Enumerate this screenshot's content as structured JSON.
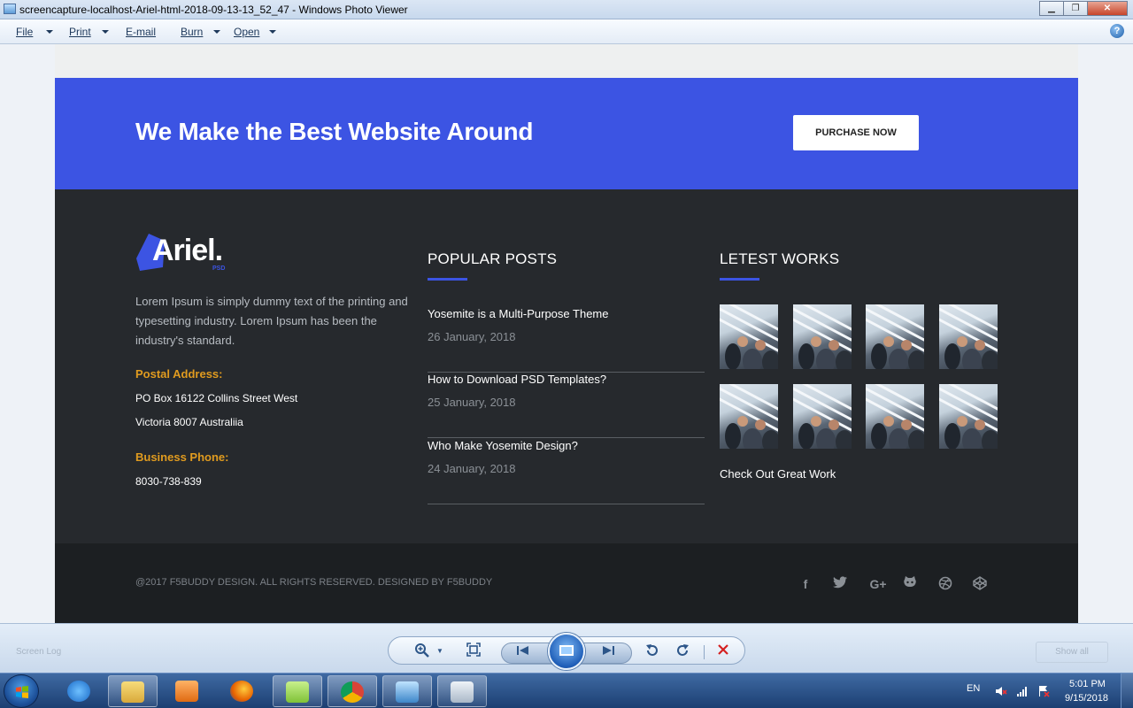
{
  "window": {
    "title": "screencapture-localhost-Ariel-html-2018-09-13-13_52_47 - Windows Photo Viewer"
  },
  "menu": {
    "items": [
      "File",
      "Print",
      "E-mail",
      "Burn",
      "Open"
    ]
  },
  "cta": {
    "title": "We Make the Best Website Around",
    "button": "PURCHASE NOW"
  },
  "footer": {
    "logo_text": "Ariel.",
    "logo_sub": "PSD",
    "about": "Lorem Ipsum is simply dummy text of the printing and typesetting industry. Lorem Ipsum has been the industry's standard.",
    "postal_label": "Postal Address:",
    "postal_line1": "PO Box 16122 Collins Street West",
    "postal_line2": "Victoria 8007 Australiia",
    "phone_label": "Business Phone:",
    "phone": "8030-738-839",
    "popular_title": "POPULAR POSTS",
    "posts": [
      {
        "title": "Yosemite is a Multi-Purpose Theme",
        "date": "26 January, 2018"
      },
      {
        "title": "How to Download PSD Templates?",
        "date": "25 January, 2018"
      },
      {
        "title": "Who Make Yosemite Design?",
        "date": "24 January, 2018"
      }
    ],
    "works_title": "LETEST WORKS",
    "works_link": "Check Out Great Work",
    "copyright": "@2017 F5BUDDY DESIGN. ALL RIGHTS RESERVED. DESIGNED BY F5BUDDY",
    "social_icons": [
      "facebook-icon",
      "twitter-icon",
      "google-plus-icon",
      "github-icon",
      "dribbble-icon",
      "codepen-icon"
    ]
  },
  "toolbar": {
    "ghost_left": "Screen Log",
    "ghost_right": "Show all"
  },
  "taskbar": {
    "language": "EN",
    "time": "5:01 PM",
    "date": "9/15/2018"
  },
  "colors": {
    "accent": "#3c54e3",
    "footer_bg": "#26292d",
    "gold": "#e09b1f"
  }
}
